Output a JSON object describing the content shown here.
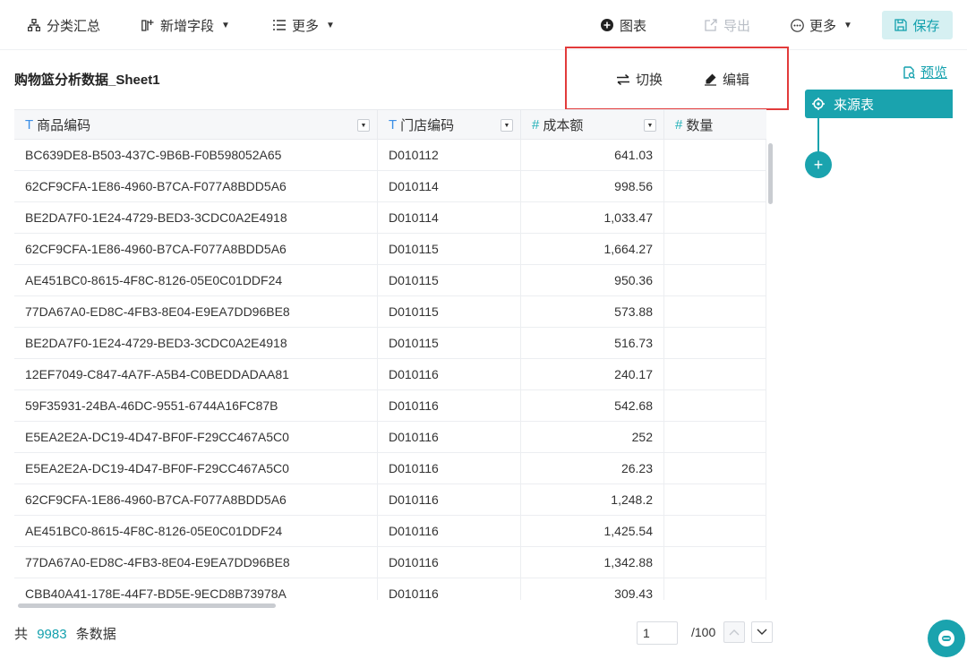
{
  "toolbar": {
    "summary_label": "分类汇总",
    "add_field_label": "新增字段",
    "more_left_label": "更多",
    "chart_label": "图表",
    "export_label": "导出",
    "more_right_label": "更多",
    "save_label": "保存"
  },
  "sheet": {
    "title": "购物篮分析数据_Sheet1",
    "switch_label": "切换",
    "edit_label": "编辑"
  },
  "table": {
    "columns": [
      {
        "label": "商品编码",
        "type_icon": "T"
      },
      {
        "label": "门店编码",
        "type_icon": "T"
      },
      {
        "label": "成本额",
        "type_icon": "#"
      },
      {
        "label": "数量",
        "type_icon": "#"
      }
    ],
    "rows": [
      [
        "BC639DE8-B503-437C-9B6B-F0B598052A65",
        "D010112",
        "641.03"
      ],
      [
        "62CF9CFA-1E86-4960-B7CA-F077A8BDD5A6",
        "D010114",
        "998.56"
      ],
      [
        "BE2DA7F0-1E24-4729-BED3-3CDC0A2E4918",
        "D010114",
        "1,033.47"
      ],
      [
        "62CF9CFA-1E86-4960-B7CA-F077A8BDD5A6",
        "D010115",
        "1,664.27"
      ],
      [
        "AE451BC0-8615-4F8C-8126-05E0C01DDF24",
        "D010115",
        "950.36"
      ],
      [
        "77DA67A0-ED8C-4FB3-8E04-E9EA7DD96BE8",
        "D010115",
        "573.88"
      ],
      [
        "BE2DA7F0-1E24-4729-BED3-3CDC0A2E4918",
        "D010115",
        "516.73"
      ],
      [
        "12EF7049-C847-4A7F-A5B4-C0BEDDADAA81",
        "D010116",
        "240.17"
      ],
      [
        "59F35931-24BA-46DC-9551-6744A16FC87B",
        "D010116",
        "542.68"
      ],
      [
        "E5EA2E2A-DC19-4D47-BF0F-F29CC467A5C0",
        "D010116",
        "252"
      ],
      [
        "E5EA2E2A-DC19-4D47-BF0F-F29CC467A5C0",
        "D010116",
        "26.23"
      ],
      [
        "62CF9CFA-1E86-4960-B7CA-F077A8BDD5A6",
        "D010116",
        "1,248.2"
      ],
      [
        "AE451BC0-8615-4F8C-8126-05E0C01DDF24",
        "D010116",
        "1,425.54"
      ],
      [
        "77DA67A0-ED8C-4FB3-8E04-E9EA7DD96BE8",
        "D010116",
        "1,342.88"
      ],
      [
        "CBB40A41-178E-44F7-BD5E-9ECD8B73978A",
        "D010116",
        "309.43"
      ]
    ]
  },
  "footer": {
    "prefix": "共",
    "total": "9983",
    "suffix": "条数据",
    "page_value": "1",
    "page_total": "/100"
  },
  "flow": {
    "preview_label": "预览",
    "source_label": "来源表",
    "add_symbol": "+"
  },
  "colors": {
    "accent": "#1aa3ae",
    "highlight_border": "#e23b3b"
  }
}
